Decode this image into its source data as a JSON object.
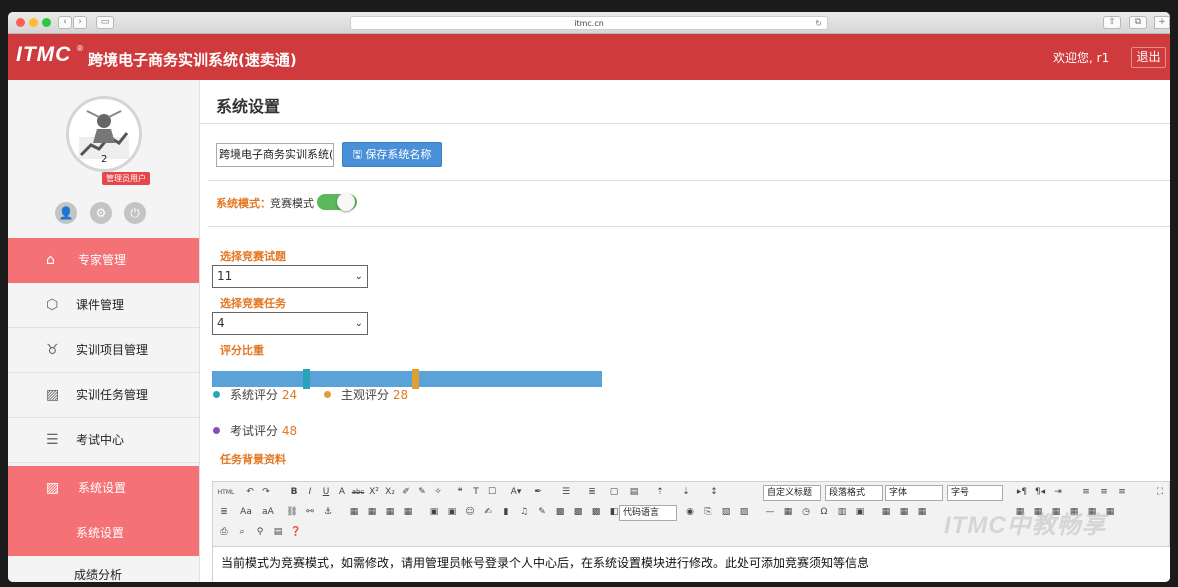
{
  "browser": {
    "url": "itmc.cn"
  },
  "header": {
    "logo": "ITMC",
    "reg": "®",
    "system_name": "跨境电子商务实训系统(速卖通)",
    "welcome": "欢迎您, r1",
    "logout": "退出"
  },
  "sidebar": {
    "avatar_number": "2",
    "role_badge": "管理员用户",
    "items": [
      {
        "label": "专家管理",
        "icon": "⌂"
      },
      {
        "label": "课件管理",
        "icon": "⬡"
      },
      {
        "label": "实训项目管理",
        "icon": "♉"
      },
      {
        "label": "实训任务管理",
        "icon": "▨"
      },
      {
        "label": "考试中心",
        "icon": "☰"
      },
      {
        "label": "系统设置",
        "icon": "▨"
      },
      {
        "label": "系统设置"
      },
      {
        "label": "成绩分析"
      }
    ]
  },
  "main": {
    "title": "系统设置",
    "system_name_value": "跨境电子商务实训系统(速卖通)",
    "save_button": "保存系统名称",
    "mode_label": "系统模式：",
    "mode_value": "竞赛模式",
    "contest_label": "选择竞赛试题",
    "contest_value": "11",
    "task_label": "选择竞赛任务",
    "task_value": "4",
    "weight_label": "评分比重",
    "legend": [
      {
        "label": "系统评分",
        "value": "24",
        "color": "#2aa3b8"
      },
      {
        "label": "主观评分",
        "value": "28",
        "color": "#e0a030"
      },
      {
        "label": "考试评分",
        "value": "48",
        "color": "#8a4db8"
      }
    ],
    "bg_label": "任务背景资料",
    "toolbar": {
      "custom_title": "自定义标题",
      "para_format": "段落格式",
      "font": "字体",
      "size": "字号",
      "code_lang": "代码语言"
    },
    "editor_text": "当前模式为竞赛模式，如需修改，请用管理员帐号登录个人中心后，在系统设置模块进行修改。此处可添加竞赛须知等信息",
    "watermark": "ITMC中教畅享"
  }
}
